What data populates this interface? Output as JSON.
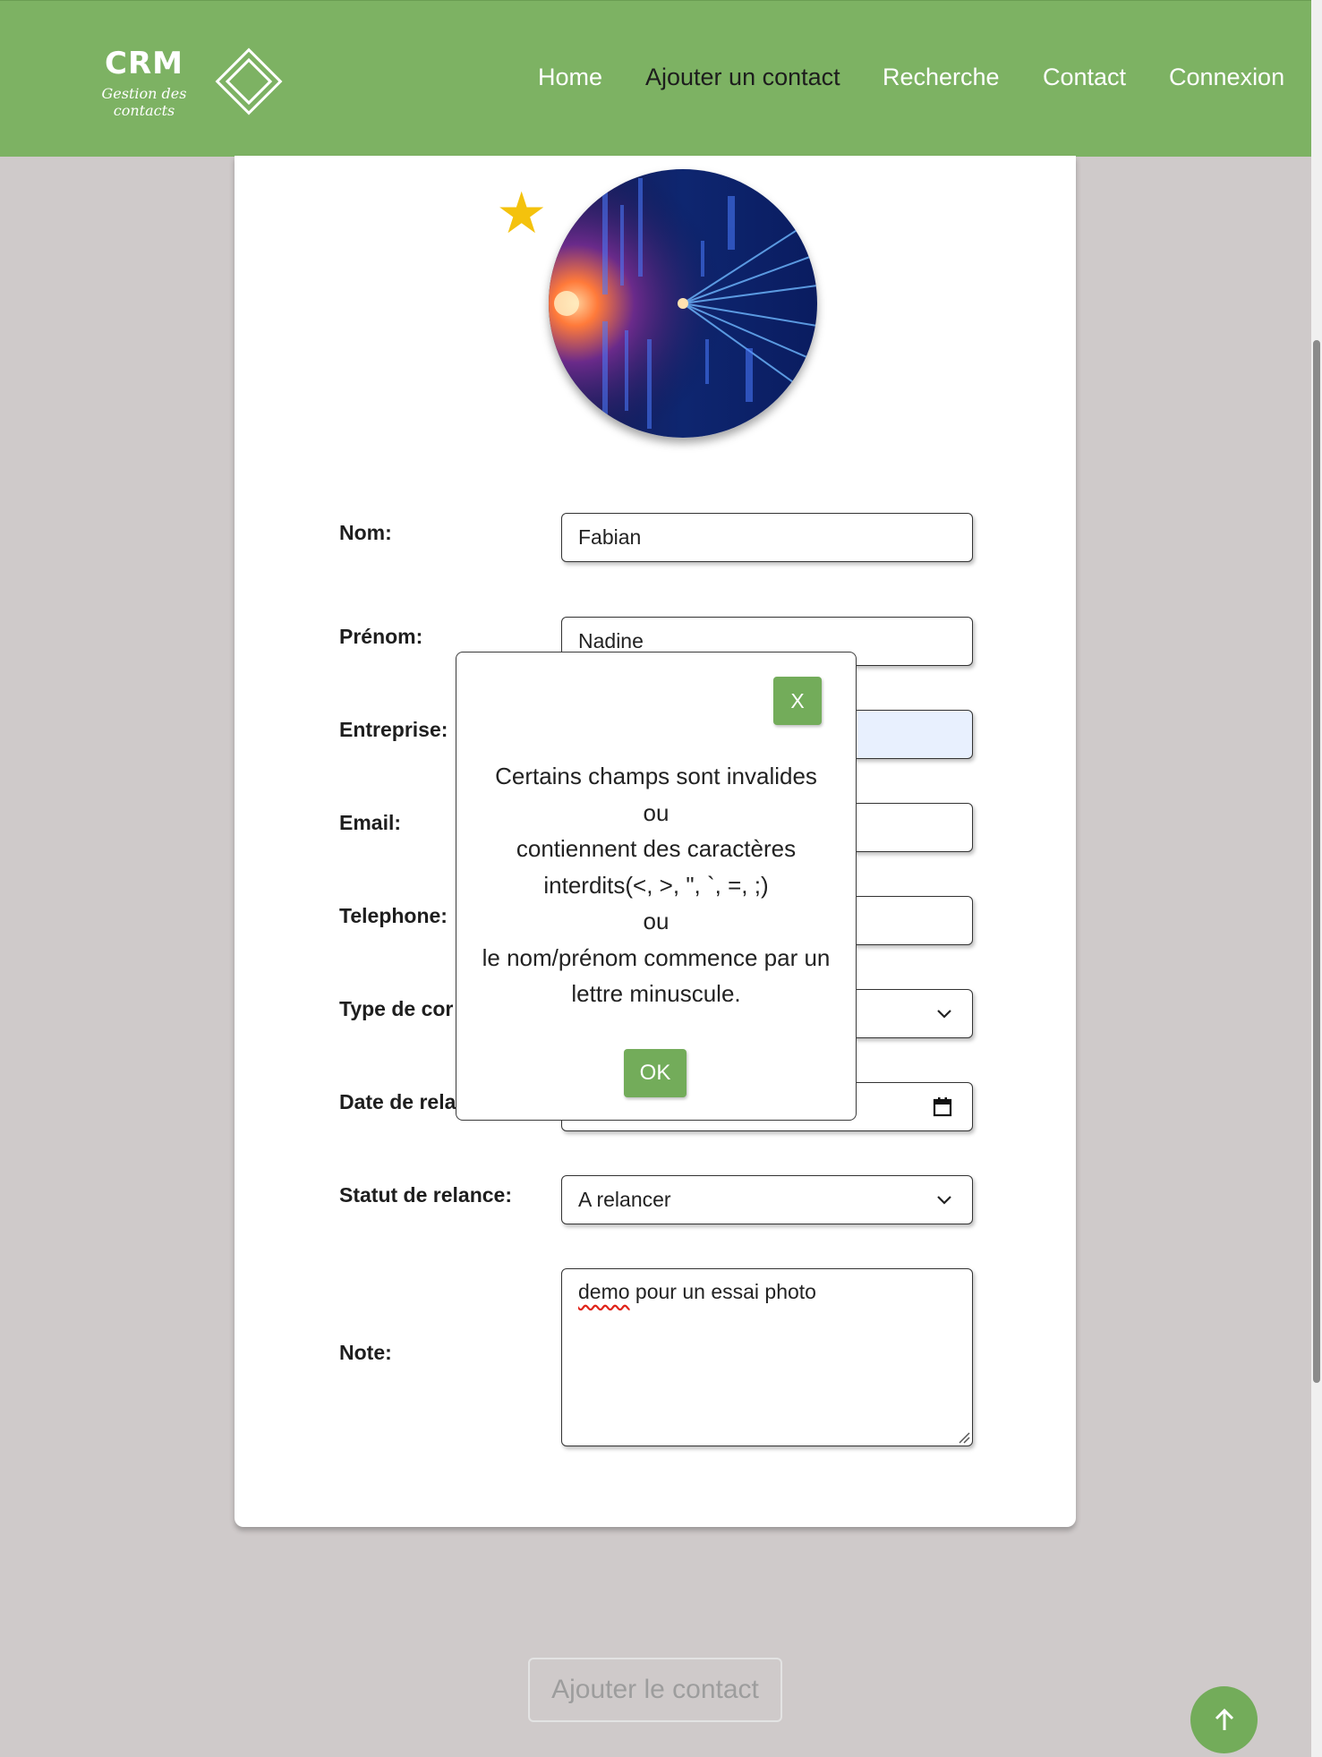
{
  "header": {
    "logo": {
      "title": "CRM",
      "subtitle": "Gestion des contacts"
    },
    "nav": [
      {
        "label": "Home"
      },
      {
        "label": "Ajouter un contact",
        "active": true
      },
      {
        "label": "Recherche"
      },
      {
        "label": "Contact"
      },
      {
        "label": "Connexion"
      }
    ],
    "background_color": "#7db263"
  },
  "form": {
    "favorite_icon": "star-icon",
    "photo_icon": "abstract-digital-tunnel-image",
    "fields": {
      "nom": {
        "label": "Nom:",
        "value": "Fabian"
      },
      "prenom": {
        "label": "Prénom:",
        "value": "Nadine"
      },
      "entreprise": {
        "label": "Entreprise:",
        "value": ""
      },
      "email": {
        "label": "Email:",
        "value": ""
      },
      "telephone": {
        "label": "Telephone:",
        "value": ""
      },
      "type_contact": {
        "label": "Type de cor",
        "value": ""
      },
      "date_relance": {
        "label": "Date de rela",
        "value": ""
      },
      "statut_relance": {
        "label": "Statut de relance:",
        "value": "A relancer"
      },
      "note": {
        "label": "Note:",
        "value_misspelled": "demo",
        "value_rest": " pour un essai photo"
      }
    },
    "submit_label": "Ajouter le contact"
  },
  "modal": {
    "close_label": "X",
    "message_lines": [
      "Certains champs sont invalides",
      "ou",
      "contiennent des caractères",
      "interdits(<, >, \", `, =, ;)",
      "ou",
      "le nom/prénom commence par un",
      "lettre minuscule."
    ],
    "ok_label": "OK"
  },
  "scroll_top_icon": "arrow-up-icon",
  "accent_color": "#73ac5a"
}
